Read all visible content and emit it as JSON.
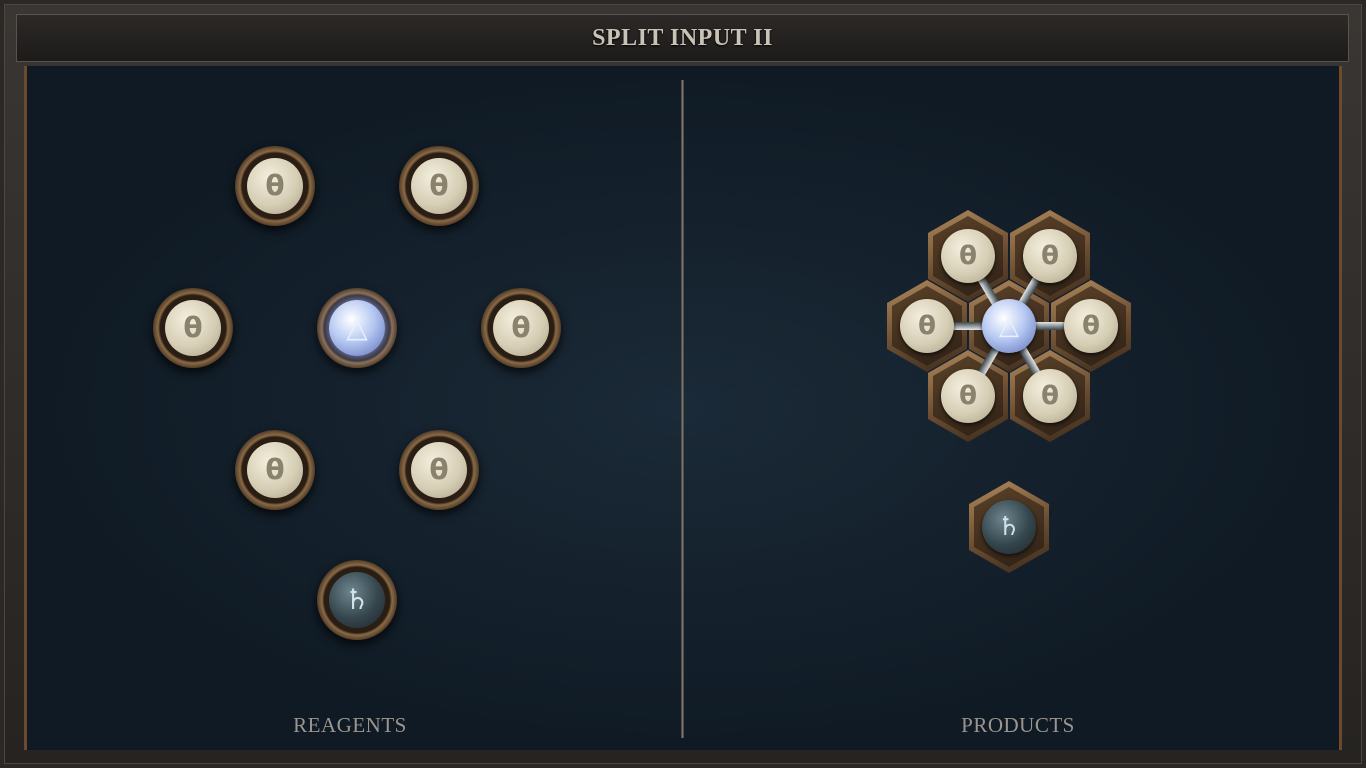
{
  "title": "SPLIT INPUT II",
  "reagents_label": "REAGENTS",
  "products_label": "PRODUCTS",
  "symbols": {
    "salt": "θ",
    "air": "△",
    "lead": "♄"
  },
  "reagents": [
    {
      "element": "salt"
    },
    {
      "element": "salt"
    },
    {
      "element": "salt"
    },
    {
      "element": "air"
    },
    {
      "element": "salt"
    },
    {
      "element": "salt"
    },
    {
      "element": "salt"
    },
    {
      "element": "lead"
    }
  ],
  "products": [
    {
      "element": "salt"
    },
    {
      "element": "salt"
    },
    {
      "element": "salt"
    },
    {
      "element": "air"
    },
    {
      "element": "salt"
    },
    {
      "element": "salt"
    },
    {
      "element": "salt"
    },
    {
      "element": "lead"
    }
  ],
  "colors": {
    "frame_wood": "#6e4a2c",
    "board": "#0f1a24",
    "title_text": "#c9c2b7",
    "label_text": "#9a958f"
  }
}
